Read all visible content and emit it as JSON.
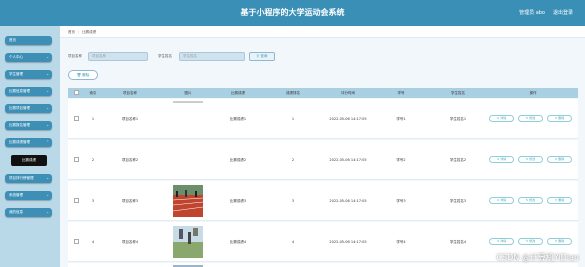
{
  "header": {
    "title": "基于小程序的大学运动会系统",
    "user": "管理员 abo",
    "logout": "退出登录"
  },
  "sidebar": {
    "items": [
      {
        "label": "首页"
      },
      {
        "label": "个人中心"
      },
      {
        "label": "学生管理"
      },
      {
        "label": "比赛信息管理"
      },
      {
        "label": "比赛项目管理"
      },
      {
        "label": "比赛报名管理"
      },
      {
        "label": "比赛成绩管理"
      },
      {
        "label": "项目排行榜管理"
      },
      {
        "label": "系统管理"
      },
      {
        "label": "我的信息"
      }
    ],
    "active_sub": "比赛成绩"
  },
  "breadcrumb": {
    "home": "首页",
    "current": "比赛成绩"
  },
  "search": {
    "label1": "项目名称",
    "placeholder1": "项目名称",
    "label2": "学生姓名",
    "placeholder2": "学生姓名",
    "button": "查询"
  },
  "toolbar": {
    "delete": "删除"
  },
  "table": {
    "headers": [
      "",
      "索引",
      "项目名称",
      "图片",
      "比赛成绩",
      "成绩排名",
      "评分时间",
      "学号",
      "学生姓名",
      "操作"
    ],
    "rows": [
      {
        "index": "1",
        "project": "项目名称1",
        "score": "比赛成绩1",
        "rank": "1",
        "time": "2022-05-06 14:17:05",
        "sid": "学号1",
        "name": "学生姓名1",
        "pic": "none"
      },
      {
        "index": "2",
        "project": "项目名称2",
        "score": "比赛成绩2",
        "rank": "2",
        "time": "2022-05-06 14:17:05",
        "sid": "学号2",
        "name": "学生姓名2",
        "pic": "none"
      },
      {
        "index": "3",
        "project": "项目名称3",
        "score": "比赛成绩3",
        "rank": "3",
        "time": "2022-05-06 14:17:05",
        "sid": "学号3",
        "name": "学生姓名3",
        "pic": "track"
      },
      {
        "index": "4",
        "project": "项目名称4",
        "score": "比赛成绩4",
        "rank": "4",
        "time": "2022-05-06 14:17:05",
        "sid": "学号4",
        "name": "学生姓名4",
        "pic": "field"
      }
    ],
    "ops": [
      "详情",
      "修改",
      "删除"
    ]
  },
  "watermark": "CSDN @计算机YiDian",
  "colors": {
    "topbar": "#3a8fb7",
    "sidebar": "#b9d8e8",
    "menu": "#3d8fb6",
    "header_row": "#a9cfe2"
  }
}
